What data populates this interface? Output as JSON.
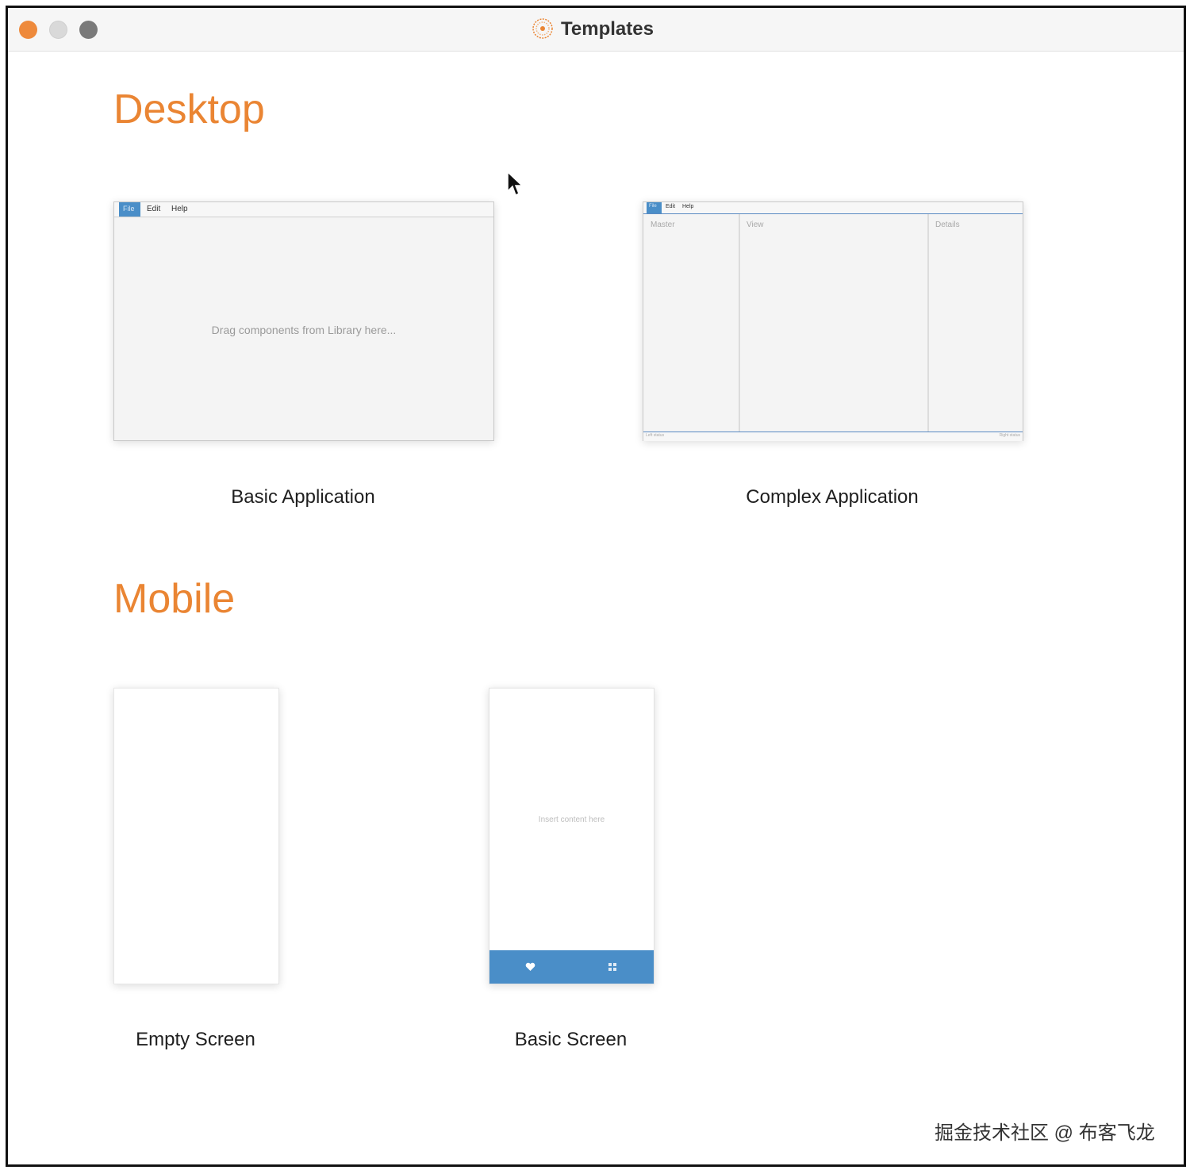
{
  "window": {
    "title": "Templates",
    "app_icon": "sunburst-logo-icon"
  },
  "sections": {
    "desktop": {
      "title": "Desktop",
      "templates": [
        {
          "label": "Basic Application",
          "preview": {
            "menu": [
              "File",
              "Edit",
              "Help"
            ],
            "placeholder": "Drag components from Library here..."
          }
        },
        {
          "label": "Complex Application",
          "preview": {
            "menu": [
              "File",
              "Edit",
              "Help"
            ],
            "panes": [
              "Master",
              "View",
              "Details"
            ],
            "status_left": "Left status",
            "status_right": "Right status"
          }
        }
      ]
    },
    "mobile": {
      "title": "Mobile",
      "templates": [
        {
          "label": "Empty Screen"
        },
        {
          "label": "Basic Screen",
          "preview": {
            "placeholder": "Insert content here",
            "tab_icons": [
              "heart-icon",
              "grid-icon"
            ]
          }
        }
      ]
    }
  },
  "watermark": "掘金技术社区 @ 布客飞龙",
  "colors": {
    "accent": "#ea8533",
    "preview_blue": "#4a8ec8",
    "close_button": "#ee8a3c"
  }
}
